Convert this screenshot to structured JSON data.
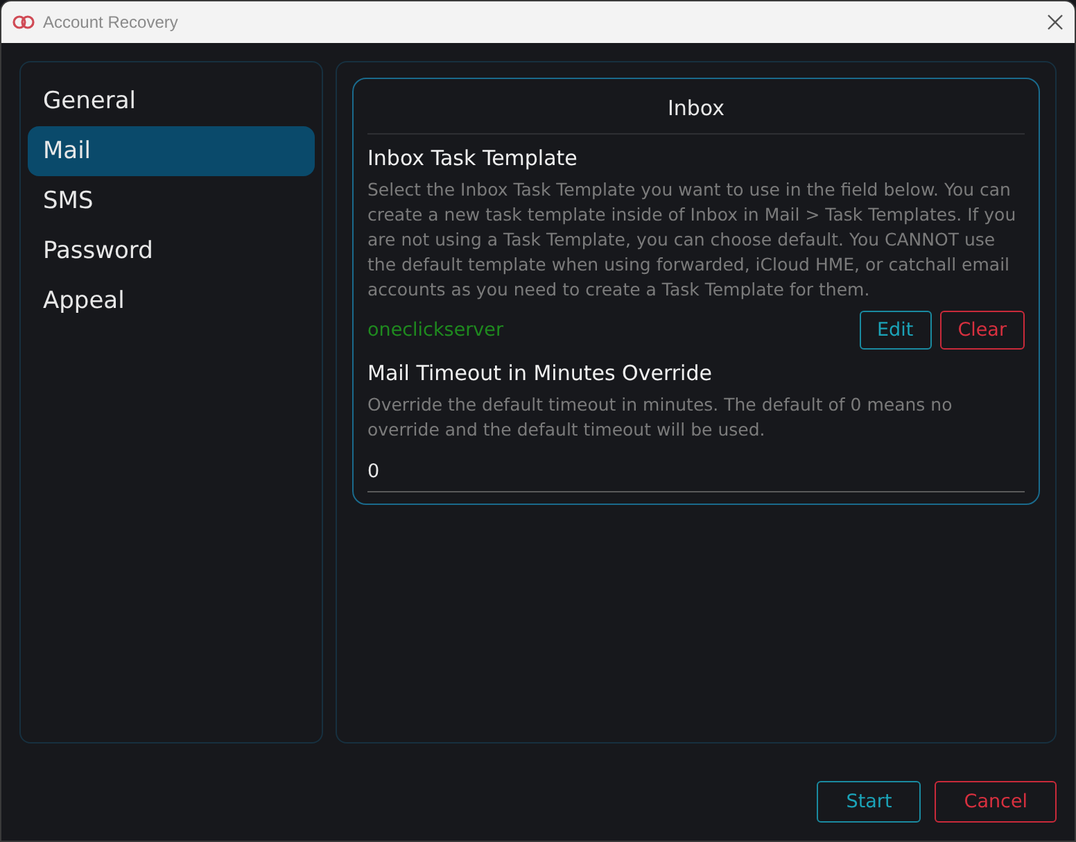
{
  "window": {
    "title": "Account Recovery"
  },
  "sidebar": {
    "items": [
      {
        "label": "General",
        "selected": false
      },
      {
        "label": "Mail",
        "selected": true
      },
      {
        "label": "SMS",
        "selected": false
      },
      {
        "label": "Password",
        "selected": false
      },
      {
        "label": "Appeal",
        "selected": false
      }
    ]
  },
  "card": {
    "title": "Inbox",
    "sections": [
      {
        "heading": "Inbox Task Template",
        "description": "Select the Inbox Task Template you want to use in the field below. You can create a new task template inside of Inbox in Mail > Task Templates. If you are not using a Task Template, you can choose default. You CANNOT use the default template when using forwarded, iCloud HME, or catchall email accounts as you need to create a Task Template for them.",
        "kind": "template",
        "value": "oneclickserver",
        "buttons": [
          {
            "label": "Edit",
            "kind": "primary"
          },
          {
            "label": "Clear",
            "kind": "danger"
          }
        ]
      },
      {
        "heading": "Mail Timeout in Minutes Override",
        "description": "Override the default timeout in minutes. The default of 0 means no override and the default timeout will be used.",
        "kind": "input",
        "value": "0"
      }
    ]
  },
  "footer": {
    "buttons": [
      {
        "label": "Start",
        "kind": "primary"
      },
      {
        "label": "Cancel",
        "kind": "danger"
      }
    ]
  }
}
